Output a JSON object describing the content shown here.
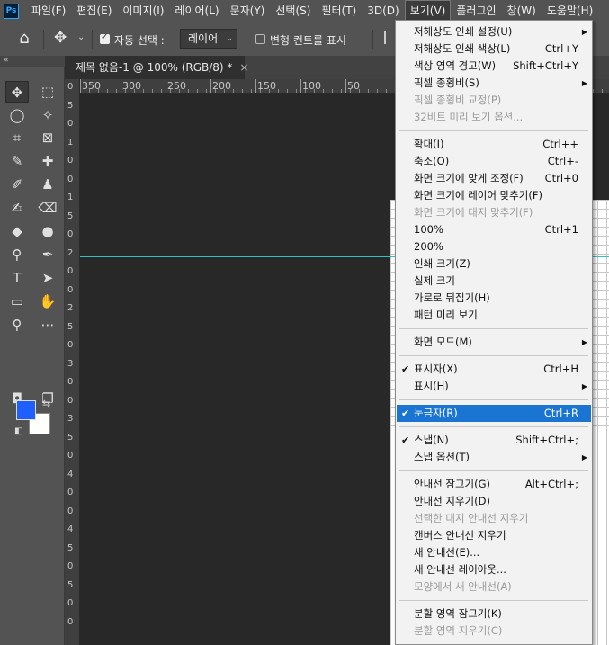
{
  "app": {
    "logo": "Ps"
  },
  "menubar": {
    "items": [
      "파일(F)",
      "편집(E)",
      "이미지(I)",
      "레이어(L)",
      "문자(Y)",
      "선택(S)",
      "필터(T)",
      "3D(D)",
      "보기(V)",
      "플러그인",
      "창(W)",
      "도움말(H)"
    ],
    "active_index": 8
  },
  "options": {
    "auto_select_label": "자동 선택 :",
    "auto_select_checked": true,
    "layer_select_value": "레이어",
    "transform_controls_label": "변형 컨트롤 표시",
    "transform_controls_checked": false
  },
  "document": {
    "tab_title": "제목 없음-1 @ 100% (RGB/8) *",
    "close_glyph": "×"
  },
  "toolbar": {
    "collapse_glyph": "«",
    "foreground_color": "#1f5eff",
    "background_color": "#ffffff"
  },
  "ruler": {
    "h_labels": [
      "350",
      "300",
      "250",
      "200",
      "150",
      "100",
      "50"
    ],
    "v_labels": [
      "0",
      "5",
      "0",
      "1",
      "0",
      "0",
      "1",
      "5",
      "0",
      "2",
      "0",
      "0",
      "2",
      "5",
      "0",
      "3",
      "0",
      "0",
      "3",
      "5",
      "0",
      "4",
      "0",
      "0",
      "4",
      "5",
      "0",
      "5",
      "0",
      "0"
    ]
  },
  "menu": {
    "items": [
      {
        "label": "저해상도 인쇄 설정(U)",
        "shortcut": "",
        "submenu": true
      },
      {
        "label": "저해상도 인쇄 색상(L)",
        "shortcut": "Ctrl+Y"
      },
      {
        "label": "색상 영역 경고(W)",
        "shortcut": "Shift+Ctrl+Y"
      },
      {
        "label": "픽셀 종횡비(S)",
        "shortcut": "",
        "submenu": true
      },
      {
        "label": "픽셀 종횡비 교정(P)",
        "shortcut": "",
        "disabled": true
      },
      {
        "label": "32비트 미리 보기 옵션...",
        "shortcut": "",
        "disabled": true
      },
      {
        "label": "확대(I)",
        "shortcut": "Ctrl++"
      },
      {
        "label": "축소(O)",
        "shortcut": "Ctrl+-"
      },
      {
        "label": "화면 크기에 맞게 조정(F)",
        "shortcut": "Ctrl+0"
      },
      {
        "label": "화면 크기에 레이어 맞추기(F)",
        "shortcut": ""
      },
      {
        "label": "화면 크기에 대지 맞추기(F)",
        "shortcut": "",
        "disabled": true
      },
      {
        "label": "100%",
        "shortcut": "Ctrl+1"
      },
      {
        "label": "200%",
        "shortcut": ""
      },
      {
        "label": "인쇄 크기(Z)",
        "shortcut": ""
      },
      {
        "label": "실제 크기",
        "shortcut": ""
      },
      {
        "label": "가로로 뒤집기(H)",
        "shortcut": ""
      },
      {
        "label": "패턴 미리 보기",
        "shortcut": ""
      },
      {
        "label": "화면 모드(M)",
        "shortcut": "",
        "submenu": true
      },
      {
        "label": "표시자(X)",
        "shortcut": "Ctrl+H",
        "checked": true
      },
      {
        "label": "표시(H)",
        "shortcut": "",
        "submenu": true
      },
      {
        "label": "눈금자(R)",
        "shortcut": "Ctrl+R",
        "checked": true,
        "highlighted": true
      },
      {
        "label": "스냅(N)",
        "shortcut": "Shift+Ctrl+;",
        "checked": true
      },
      {
        "label": "스냅 옵션(T)",
        "shortcut": "",
        "submenu": true
      },
      {
        "label": "안내선 잠그기(G)",
        "shortcut": "Alt+Ctrl+;"
      },
      {
        "label": "안내선 지우기(D)",
        "shortcut": ""
      },
      {
        "label": "선택한 대지 안내선 지우기",
        "shortcut": "",
        "disabled": true
      },
      {
        "label": "캔버스 안내선 지우기",
        "shortcut": ""
      },
      {
        "label": "새 안내선(E)...",
        "shortcut": ""
      },
      {
        "label": "새 안내선 레이아웃...",
        "shortcut": ""
      },
      {
        "label": "모양에서 새 안내선(A)",
        "shortcut": "",
        "disabled": true
      },
      {
        "label": "분할 영역 잠그기(K)",
        "shortcut": ""
      },
      {
        "label": "분할 영역 지우기(C)",
        "shortcut": "",
        "disabled": true
      }
    ]
  }
}
